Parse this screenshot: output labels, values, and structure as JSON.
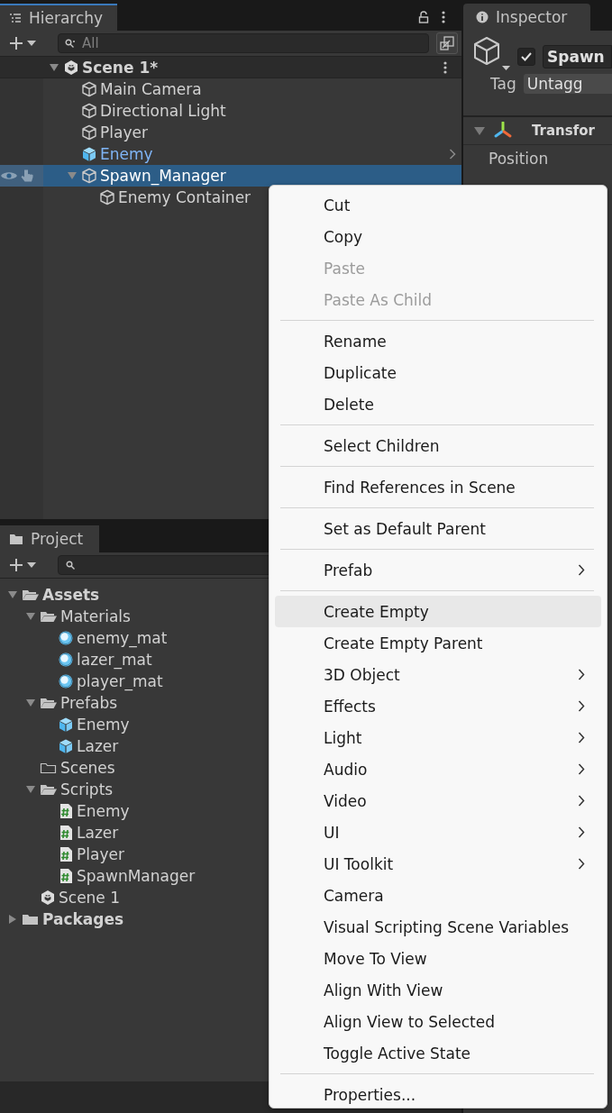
{
  "hierarchy": {
    "title": "Hierarchy",
    "search": {
      "placeholder": "All"
    },
    "items": [
      {
        "label": "Scene 1*",
        "kind": "scene",
        "expanded": true,
        "children": [
          {
            "label": "Main Camera",
            "kind": "object",
            "selected": false
          },
          {
            "label": "Directional Light",
            "kind": "object",
            "selected": false
          },
          {
            "label": "Player",
            "kind": "object",
            "selected": false
          },
          {
            "label": "Enemy",
            "kind": "prefab",
            "selected": false
          },
          {
            "label": "Spawn_Manager",
            "kind": "object",
            "selected": true,
            "expanded": true,
            "children": [
              {
                "label": "Enemy Container",
                "kind": "object",
                "selected": false
              }
            ]
          }
        ]
      }
    ]
  },
  "inspector": {
    "title": "Inspector",
    "active": true,
    "object_name": "Spawn",
    "tag_label": "Tag",
    "tag_value": "Untagg",
    "component": "Transfor",
    "fields": [
      "Position"
    ]
  },
  "project": {
    "title": "Project",
    "items": [
      {
        "label": "Assets",
        "kind": "folder",
        "expanded": true,
        "children": [
          {
            "label": "Materials",
            "kind": "folder",
            "expanded": true,
            "children": [
              {
                "label": "enemy_mat",
                "kind": "material"
              },
              {
                "label": "lazer_mat",
                "kind": "material"
              },
              {
                "label": "player_mat",
                "kind": "material"
              }
            ]
          },
          {
            "label": "Prefabs",
            "kind": "folder",
            "expanded": true,
            "children": [
              {
                "label": "Enemy",
                "kind": "prefab"
              },
              {
                "label": "Lazer",
                "kind": "prefab"
              }
            ]
          },
          {
            "label": "Scenes",
            "kind": "folder"
          },
          {
            "label": "Scripts",
            "kind": "folder",
            "expanded": true,
            "children": [
              {
                "label": "Enemy",
                "kind": "script"
              },
              {
                "label": "Lazer",
                "kind": "script"
              },
              {
                "label": "Player",
                "kind": "script"
              },
              {
                "label": "SpawnManager",
                "kind": "script"
              }
            ]
          },
          {
            "label": "Scene 1",
            "kind": "scene"
          }
        ]
      },
      {
        "label": "Packages",
        "kind": "folder",
        "expanded": false
      }
    ]
  },
  "context_menu": [
    {
      "kind": "item",
      "label": "Cut",
      "disabled": false
    },
    {
      "kind": "item",
      "label": "Copy",
      "disabled": false
    },
    {
      "kind": "item",
      "label": "Paste",
      "disabled": true
    },
    {
      "kind": "item",
      "label": "Paste As Child",
      "disabled": true
    },
    {
      "kind": "separator"
    },
    {
      "kind": "item",
      "label": "Rename",
      "disabled": false
    },
    {
      "kind": "item",
      "label": "Duplicate",
      "disabled": false
    },
    {
      "kind": "item",
      "label": "Delete",
      "disabled": false
    },
    {
      "kind": "separator"
    },
    {
      "kind": "item",
      "label": "Select Children",
      "disabled": false
    },
    {
      "kind": "separator"
    },
    {
      "kind": "item",
      "label": "Find References in Scene",
      "disabled": false
    },
    {
      "kind": "separator"
    },
    {
      "kind": "item",
      "label": "Set as Default Parent",
      "disabled": false
    },
    {
      "kind": "separator"
    },
    {
      "kind": "item",
      "label": "Prefab",
      "submenu": true
    },
    {
      "kind": "separator"
    },
    {
      "kind": "item",
      "label": "Create Empty",
      "selected": true
    },
    {
      "kind": "item",
      "label": "Create Empty Parent"
    },
    {
      "kind": "item",
      "label": "3D Object",
      "submenu": true
    },
    {
      "kind": "item",
      "label": "Effects",
      "submenu": true
    },
    {
      "kind": "item",
      "label": "Light",
      "submenu": true
    },
    {
      "kind": "item",
      "label": "Audio",
      "submenu": true
    },
    {
      "kind": "item",
      "label": "Video",
      "submenu": true
    },
    {
      "kind": "item",
      "label": "UI",
      "submenu": true
    },
    {
      "kind": "item",
      "label": "UI Toolkit",
      "submenu": true
    },
    {
      "kind": "item",
      "label": "Camera"
    },
    {
      "kind": "item",
      "label": "Visual Scripting Scene Variables"
    },
    {
      "kind": "item",
      "label": "Move To View"
    },
    {
      "kind": "item",
      "label": "Align With View"
    },
    {
      "kind": "item",
      "label": "Align View to Selected"
    },
    {
      "kind": "item",
      "label": "Toggle Active State"
    },
    {
      "kind": "separator"
    },
    {
      "kind": "item",
      "label": "Properties..."
    }
  ]
}
